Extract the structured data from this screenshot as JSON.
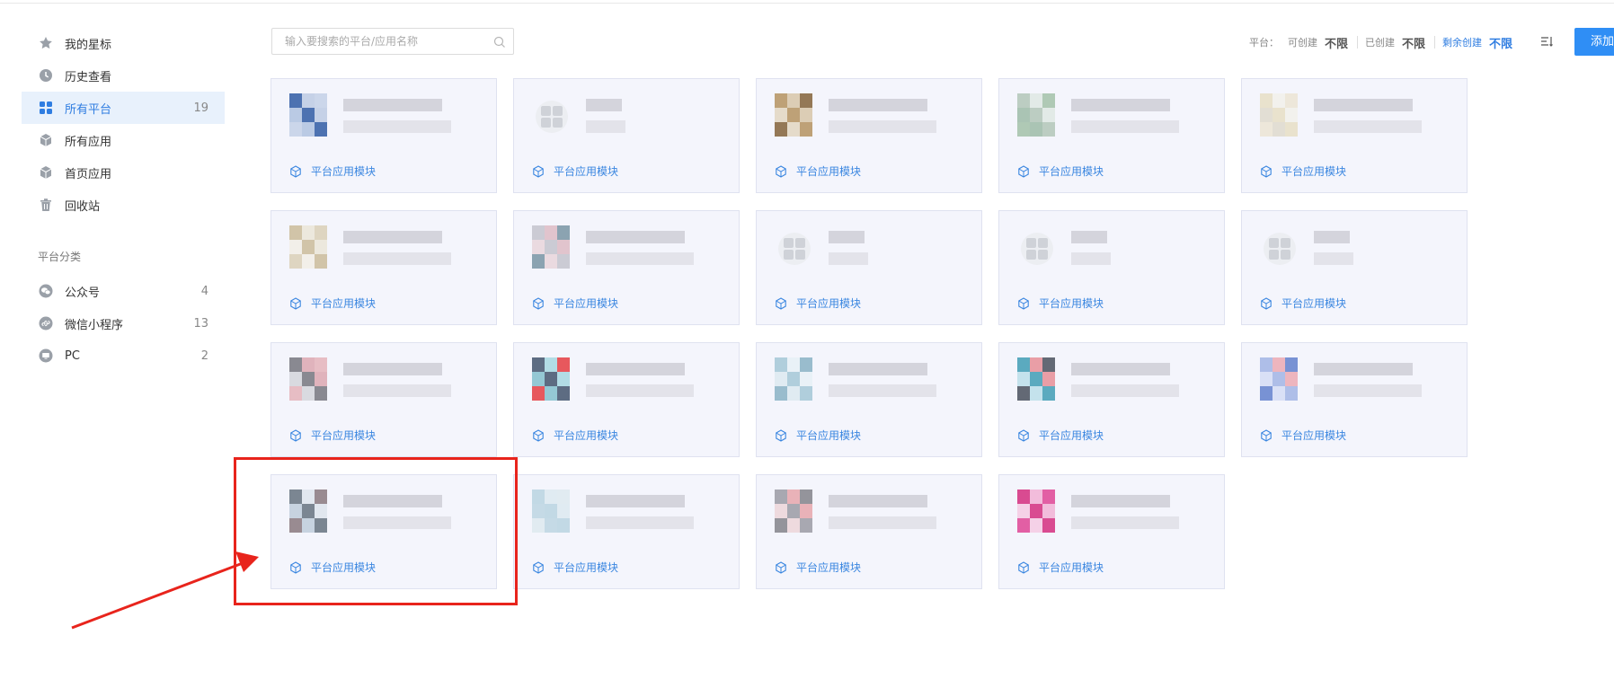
{
  "sidebar": {
    "items": [
      {
        "label": "我的星标",
        "count": "",
        "icon": "star-icon"
      },
      {
        "label": "历史查看",
        "count": "",
        "icon": "clock-icon"
      },
      {
        "label": "所有平台",
        "count": "19",
        "icon": "grid-icon"
      },
      {
        "label": "所有应用",
        "count": "",
        "icon": "cube-icon"
      },
      {
        "label": "首页应用",
        "count": "",
        "icon": "cube-icon"
      },
      {
        "label": "回收站",
        "count": "",
        "icon": "trash-icon"
      }
    ],
    "category_title": "平台分类",
    "categories": [
      {
        "label": "公众号",
        "count": "4",
        "icon": "wechat-icon"
      },
      {
        "label": "微信小程序",
        "count": "13",
        "icon": "miniprogram-icon"
      },
      {
        "label": "PC",
        "count": "2",
        "icon": "monitor-icon"
      }
    ]
  },
  "search": {
    "placeholder": "输入要搜索的平台/应用名称"
  },
  "quota": {
    "platform_label": "平台：",
    "creatable_label": "可创建",
    "creatable_value": "不限",
    "created_label": "已创建",
    "created_value": "不限",
    "remaining_label": "剩余创建",
    "remaining_value": "不限"
  },
  "add_button": "添加",
  "cards": [
    {
      "module": "平台应用模块"
    },
    {
      "module": "平台应用模块"
    },
    {
      "module": "平台应用模块"
    },
    {
      "module": "平台应用模块"
    },
    {
      "module": "平台应用模块"
    },
    {
      "module": "平台应用模块"
    },
    {
      "module": "平台应用模块"
    },
    {
      "module": "平台应用模块"
    },
    {
      "module": "平台应用模块"
    },
    {
      "module": "平台应用模块"
    },
    {
      "module": "平台应用模块"
    },
    {
      "module": "平台应用模块"
    },
    {
      "module": "平台应用模块"
    },
    {
      "module": "平台应用模块"
    },
    {
      "module": "平台应用模块"
    },
    {
      "module": "平台应用模块"
    },
    {
      "module": "平台应用模块"
    },
    {
      "module": "平台应用模块"
    },
    {
      "module": "平台应用模块"
    }
  ],
  "colors": {
    "accent": "#2f7de1",
    "annotation": "#e8241c"
  }
}
